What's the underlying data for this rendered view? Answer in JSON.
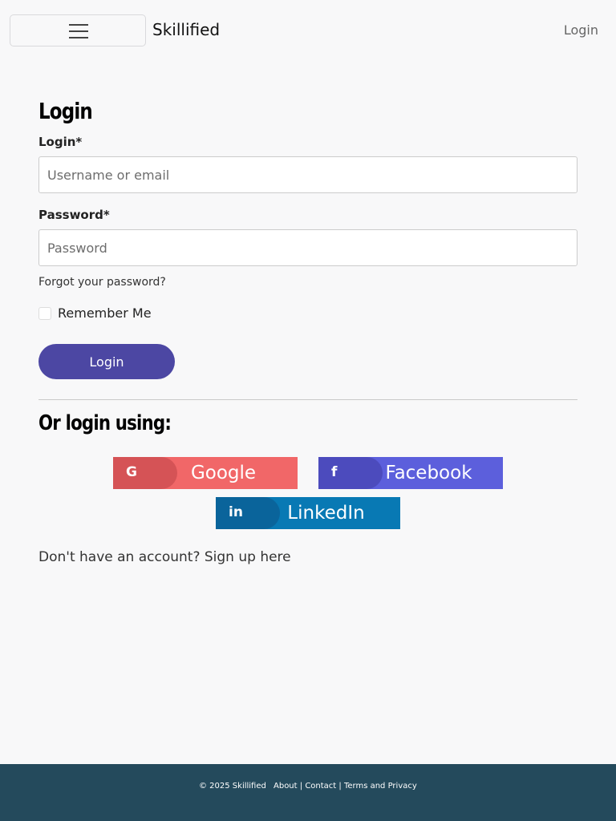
{
  "navbar": {
    "brand": "Skillified",
    "login_link": "Login",
    "menu_icon": "hamburger-icon"
  },
  "form": {
    "title": "Login",
    "login_label": "Login*",
    "login_placeholder": "Username or email",
    "login_value": "",
    "password_label": "Password*",
    "password_placeholder": "Password",
    "password_value": "",
    "forgot_link": "Forgot your password?",
    "remember_label": "Remember Me",
    "remember_checked": false,
    "submit_label": "Login"
  },
  "social": {
    "title": "Or login using:",
    "buttons": [
      {
        "label": "Google",
        "icon": "google-icon",
        "glyph": "G",
        "color": "#f16768"
      },
      {
        "label": "Facebook",
        "icon": "facebook-icon",
        "glyph": "f",
        "color": "#5c5fdc"
      },
      {
        "label": "LinkedIn",
        "icon": "linkedin-icon",
        "glyph": "in",
        "color": "#0879b4"
      }
    ]
  },
  "signup": {
    "prefix": "Don't have an account?",
    "link": "Sign up here"
  },
  "footer": {
    "copyright": "© 2025 Skillified",
    "links": [
      "About",
      "Contact",
      "Terms and Privacy"
    ],
    "separator": " | "
  },
  "colors": {
    "primary": "#4c47a3",
    "footer_bg": "#244a5c",
    "background": "#f8f8f9"
  }
}
